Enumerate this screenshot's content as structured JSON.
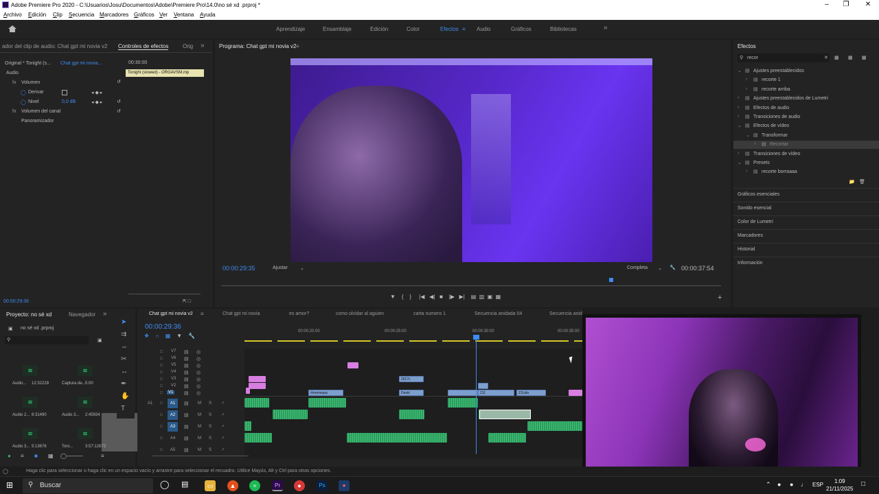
{
  "window": {
    "title": "Adobe Premiere Pro 2020 - C:\\Usuarios\\Josu\\Documentos\\Adobe\\Premiere Pro\\14.0\\no sé xd .prproj *"
  },
  "menu": [
    "Archivo",
    "Edición",
    "Clip",
    "Secuencia",
    "Marcadores",
    "Gráficos",
    "Ver",
    "Ventana",
    "Ayuda"
  ],
  "workspaces": [
    "Aprendizaje",
    "Ensamblaje",
    "Edición",
    "Color",
    "Efectos",
    "Audio",
    "Gráficos",
    "Bibliotecas"
  ],
  "workspace_active": "Efectos",
  "source_panel": {
    "tabs": [
      "ador del clip de audio: Chat gpt mi novia v2",
      "Controles de efectos",
      "Orig"
    ],
    "master": "Original * Tonight (s...",
    "seq": "Chat gpt mi novia...",
    "timecode": "00:30:00",
    "clip_tooltip": "Tonight (slowed) - ORGAVSM.mp",
    "section": "Audio",
    "volumen": "Volumen",
    "derivar": "Derivar",
    "nivel": "Nivel",
    "nivel_val": "0,0 dB",
    "vol_canal": "Volumen del canal",
    "panoramizador": "Panoramizador",
    "footer_tc": "00:00:29:36"
  },
  "program": {
    "title": "Programa: Chat gpt mi novia v2",
    "timecode": "00:00:29:35",
    "fit": "Ajustar",
    "quality": "Completa",
    "duration": "00:00:37:54"
  },
  "effects": {
    "title": "Efectos",
    "search": "recor",
    "tree": [
      {
        "label": "Ajustes preestablecidos",
        "lvl": 0,
        "open": true
      },
      {
        "label": "recorte 1",
        "lvl": 1
      },
      {
        "label": "recorte arriba",
        "lvl": 1
      },
      {
        "label": "Ajustes preestablecidos de Lumetri",
        "lvl": 0
      },
      {
        "label": "Efectos de audio",
        "lvl": 0
      },
      {
        "label": "Transiciones de audio",
        "lvl": 0
      },
      {
        "label": "Efectos de vídeo",
        "lvl": 0,
        "open": true
      },
      {
        "label": "Transformar",
        "lvl": 1,
        "open": true
      },
      {
        "label": "Recortar",
        "lvl": 2,
        "sel": true
      },
      {
        "label": "Transiciones de vídeo",
        "lvl": 0
      },
      {
        "label": "Presets",
        "lvl": 0,
        "open": true
      },
      {
        "label": "recorte borraaaa",
        "lvl": 1
      }
    ],
    "sections": [
      "Gráficos esenciales",
      "Sonido esencial",
      "Color de Lumetri",
      "Marcadores",
      "Historial",
      "Información"
    ]
  },
  "project": {
    "tabs": [
      "Proyecto: no sé xd",
      "Navegador"
    ],
    "file": "no sé xd .prproj",
    "items": [
      {
        "name": "Audio...",
        "dur": "12:32228"
      },
      {
        "name": "Captura de...",
        "dur": "5:00"
      },
      {
        "name": "Audio 2...",
        "dur": "6:31490"
      },
      {
        "name": "Audio 3...",
        "dur": "2:45934"
      },
      {
        "name": "Audio 3...",
        "dur": "5:13676"
      },
      {
        "name": "Toni...",
        "dur": "3:57:12672"
      }
    ]
  },
  "timeline": {
    "tabs": [
      "Chat gpt mi novia v2",
      "Chat gpt mi novia",
      "es amor?",
      "como olvidar al aguien",
      "carta numero 1",
      "Secuencia anidada 04",
      "Secuencia anid"
    ],
    "timecode": "00:00:29:36",
    "ruler": [
      "00:00:20:00",
      "00:00:25:00",
      "00:00:30:00",
      "00:00:35:00"
    ],
    "tracks_v": [
      "V7",
      "V6",
      "V5",
      "V4",
      "V3",
      "V2",
      "V1"
    ],
    "tracks_a": [
      "A1",
      "A2",
      "A3",
      "A4",
      "A5"
    ],
    "clip_labels": [
      "2017c",
      "#memespa",
      "Deskt",
      "211",
      "211afa"
    ]
  },
  "status": "Haga clic para seleccionar o haga clic en un espacio vacío y arrastre para seleccionar el recuadro. Utilice Mayús, Alt y Ctrl para otras opciones.",
  "taskbar": {
    "search": "Buscar",
    "lang": "ESP",
    "time": "1:09",
    "date": "21/11/2025"
  }
}
